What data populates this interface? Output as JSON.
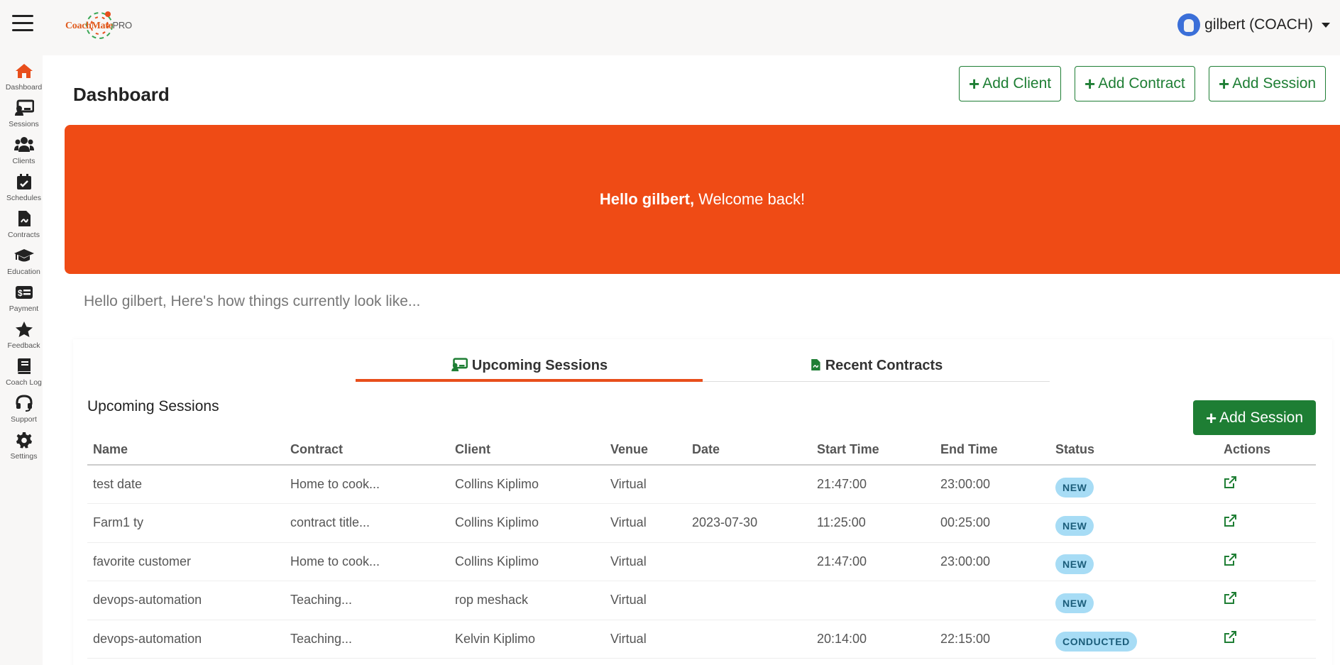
{
  "app": {
    "logo_brand": "CoachMate",
    "logo_suffix": "PRO"
  },
  "user": {
    "display_name": "gilbert (COACH)"
  },
  "sidebar": {
    "items": [
      {
        "label": "Dashboard",
        "icon": "home-icon"
      },
      {
        "label": "Sessions",
        "icon": "sessions-icon"
      },
      {
        "label": "Clients",
        "icon": "clients-icon"
      },
      {
        "label": "Schedules",
        "icon": "calendar-icon"
      },
      {
        "label": "Contracts",
        "icon": "contract-icon"
      },
      {
        "label": "Education",
        "icon": "graduation-cap-icon"
      },
      {
        "label": "Payment",
        "icon": "payment-icon"
      },
      {
        "label": "Feedback",
        "icon": "star-icon"
      },
      {
        "label": "Coach Log",
        "icon": "book-icon"
      },
      {
        "label": "Support",
        "icon": "headset-icon"
      },
      {
        "label": "Settings",
        "icon": "gear-icon"
      }
    ]
  },
  "header": {
    "title": "Dashboard",
    "buttons": {
      "add_client": "Add Client",
      "add_contract": "Add Contract",
      "add_session": "Add Session"
    }
  },
  "banner": {
    "greeting": "Hello gilbert,",
    "message": "Welcome back!"
  },
  "subtitle": "Hello gilbert, Here's how things currently look like...",
  "tabs": [
    {
      "label": "Upcoming Sessions",
      "icon": "sessions-icon",
      "active": true
    },
    {
      "label": "Recent Contracts",
      "icon": "contract-icon",
      "active": false
    }
  ],
  "section": {
    "title": "Upcoming Sessions",
    "add_button": "Add Session"
  },
  "table": {
    "columns": [
      "Name",
      "Contract",
      "Client",
      "Venue",
      "Date",
      "Start Time",
      "End Time",
      "Status",
      "Actions"
    ],
    "rows": [
      {
        "name": "test date",
        "contract": "Home to cook...",
        "client": "Collins Kiplimo",
        "venue": "Virtual",
        "date": "",
        "start": "21:47:00",
        "end": "23:00:00",
        "status": "NEW"
      },
      {
        "name": "Farm1 ty",
        "contract": "contract title...",
        "client": "Collins Kiplimo",
        "venue": "Virtual",
        "date": "2023-07-30",
        "start": "11:25:00",
        "end": "00:25:00",
        "status": "NEW"
      },
      {
        "name": "favorite customer",
        "contract": "Home to cook...",
        "client": "Collins Kiplimo",
        "venue": "Virtual",
        "date": "",
        "start": "21:47:00",
        "end": "23:00:00",
        "status": "NEW"
      },
      {
        "name": "devops-automation",
        "contract": "Teaching...",
        "client": "rop meshack",
        "venue": "Virtual",
        "date": "",
        "start": "",
        "end": "",
        "status": "NEW"
      },
      {
        "name": "devops-automation",
        "contract": "Teaching...",
        "client": "Kelvin Kiplimo",
        "venue": "Virtual",
        "date": "",
        "start": "20:14:00",
        "end": "22:15:00",
        "status": "CONDUCTED"
      }
    ]
  },
  "colors": {
    "accent_orange": "#ef4b15",
    "brand_green": "#1e7e34",
    "badge_blue": "#a7dcf5"
  }
}
